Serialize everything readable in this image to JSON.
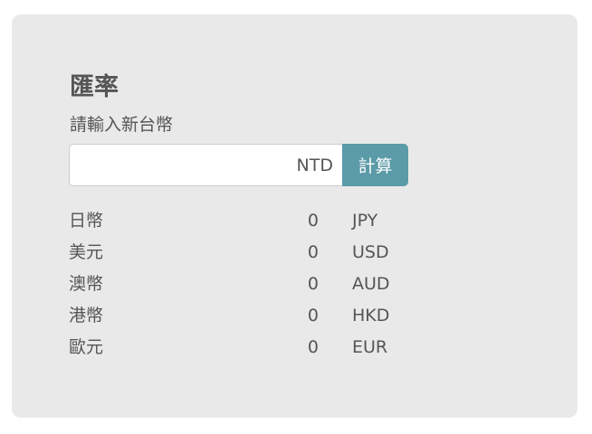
{
  "title": "匯率",
  "prompt": "請輸入新台幣",
  "input": {
    "value": "",
    "placeholder": "",
    "unit": "NTD"
  },
  "button": {
    "label": "計算"
  },
  "colors": {
    "card_background": "#e9e9e9",
    "button_background": "#5b9aa7",
    "text": "#555555"
  },
  "rates": [
    {
      "name": "日幣",
      "value": "0",
      "code": "JPY"
    },
    {
      "name": "美元",
      "value": "0",
      "code": "USD"
    },
    {
      "name": "澳幣",
      "value": "0",
      "code": "AUD"
    },
    {
      "name": "港幣",
      "value": "0",
      "code": "HKD"
    },
    {
      "name": "歐元",
      "value": "0",
      "code": "EUR"
    }
  ]
}
